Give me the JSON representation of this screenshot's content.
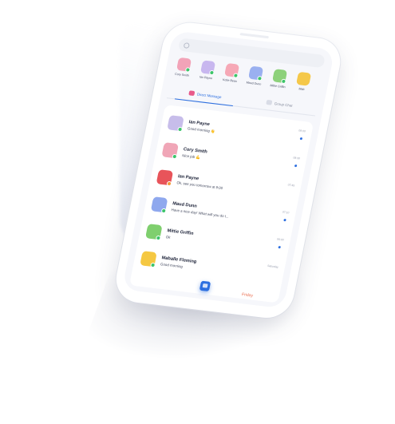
{
  "search": {
    "placeholder": ""
  },
  "stories": [
    {
      "name": "Cory Smith",
      "color": "#f2a3b8",
      "online": true
    },
    {
      "name": "Ian Payne",
      "color": "#c8b7ef",
      "online": true
    },
    {
      "name": "Kobe Bean",
      "color": "#f6a8b6",
      "online": true
    },
    {
      "name": "Maud Dunn",
      "color": "#9ab0f0",
      "online": true
    },
    {
      "name": "Mittie Griffin",
      "color": "#8dd17b",
      "online": true
    },
    {
      "name": "Mab",
      "color": "#f5c84a",
      "online": false
    }
  ],
  "tabs": [
    {
      "label": "Direct Message",
      "active": true,
      "icon": "chat-icon"
    },
    {
      "label": "Group Chat",
      "active": false,
      "icon": "group-icon"
    }
  ],
  "conversations": [
    {
      "name": "Ian Payne",
      "message": "Good morning 👋",
      "time": "09:00",
      "unread": true,
      "color": "#c7bdea",
      "status": "#3cc46a"
    },
    {
      "name": "Cory Smith",
      "message": "Nice job 💪",
      "time": "08:30",
      "unread": true,
      "color": "#f0a6b7",
      "status": "#3cc46a"
    },
    {
      "name": "Ian Payne",
      "message": "Ok, see you tomorrow at 9:00",
      "time": "07:45",
      "unread": false,
      "color": "#e8545a",
      "status": "#f29a3b"
    },
    {
      "name": "Maud Dunn",
      "message": "Have a nice day! What will you do t...",
      "time": "07:10",
      "unread": true,
      "color": "#8fa8ee",
      "status": "#3cc46a"
    },
    {
      "name": "Mittie Griffin",
      "message": "Ok",
      "time": "06:00",
      "unread": true,
      "color": "#7fcf6e",
      "status": "#3cc46a"
    },
    {
      "name": "Maballe Fleming",
      "message": "Good morning",
      "time": "Saturday",
      "unread": false,
      "color": "#f5c842",
      "status": "#3cc46a"
    }
  ],
  "footer": {
    "extra_time": "Friday"
  },
  "colors": {
    "accent": "#2d6fe0",
    "online": "#3cc46a"
  }
}
